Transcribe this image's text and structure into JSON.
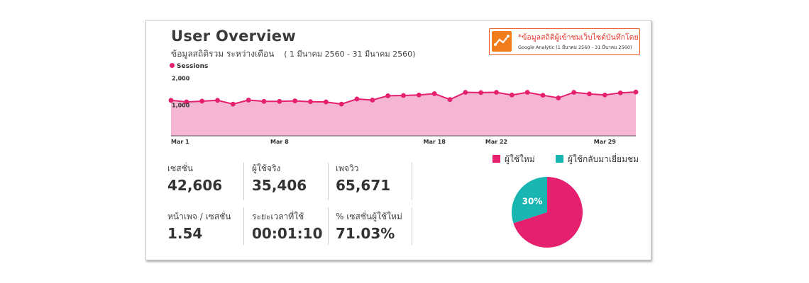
{
  "title": "User Overview",
  "subtitle": "ข้อมูลสถิติรวม ระหว่างเดือน",
  "date_range": "( 1 มีนาคม 2560 -  31 มีนาคม 2560)",
  "google_box": {
    "line1": "*ข้อมูลสถิติผู้เข้าชมเว็บไซต์บันทึกโดย",
    "line2": "Google Analytic (1 มีนาคม  2560 -  31 มีนาคม  2560)"
  },
  "colors": {
    "pink": "#e5206e",
    "area": "#f4b6d3",
    "teal": "#19b5b0",
    "orange": "#f07c1c"
  },
  "chart_data": [
    {
      "type": "area",
      "legend": "Sessions",
      "x_tick_labels": [
        {
          "day": 1,
          "label": "Mar 1"
        },
        {
          "day": 8,
          "label": "Mar 8"
        },
        {
          "day": 18,
          "label": "Mar 18"
        },
        {
          "day": 22,
          "label": "Mar 22"
        },
        {
          "day": 29,
          "label": "Mar 29"
        }
      ],
      "y_tick_labels": [
        {
          "value": 1000,
          "label": "1,000"
        },
        {
          "value": 2000,
          "label": "2,000"
        }
      ],
      "ylim": [
        0,
        2200
      ],
      "series": [
        {
          "name": "Sessions",
          "x": [
            1,
            2,
            3,
            4,
            5,
            6,
            7,
            8,
            9,
            10,
            11,
            12,
            13,
            14,
            15,
            16,
            17,
            18,
            19,
            20,
            21,
            22,
            23,
            24,
            25,
            26,
            27,
            28,
            29,
            30,
            31
          ],
          "values": [
            1330,
            1270,
            1300,
            1330,
            1190,
            1340,
            1290,
            1290,
            1310,
            1280,
            1270,
            1190,
            1380,
            1340,
            1500,
            1510,
            1530,
            1580,
            1360,
            1630,
            1620,
            1630,
            1530,
            1630,
            1520,
            1420,
            1630,
            1570,
            1530,
            1610,
            1640
          ]
        }
      ],
      "grid": false
    },
    {
      "type": "pie",
      "categories": [
        "ผู้ใช้ใหม่",
        "ผู้ใช้กลับมาเยี่ยมชม"
      ],
      "values": [
        70,
        30
      ],
      "data_labels": [
        "",
        "30%"
      ],
      "legend_position": "top"
    }
  ],
  "metrics": [
    {
      "label": "เซสชั่น",
      "value": "42,606"
    },
    {
      "label": "ผู้ใช้จริง",
      "value": "35,406"
    },
    {
      "label": "เพจวิว",
      "value": "65,671"
    },
    {
      "label": "หน้าเพจ / เซสชั่น",
      "value": "1.54"
    },
    {
      "label": "ระยะเวลาที่ใช้",
      "value": "00:01:10"
    },
    {
      "label": "% เซสชั่นผู้ใช้ใหม่",
      "value": "71.03%"
    }
  ]
}
